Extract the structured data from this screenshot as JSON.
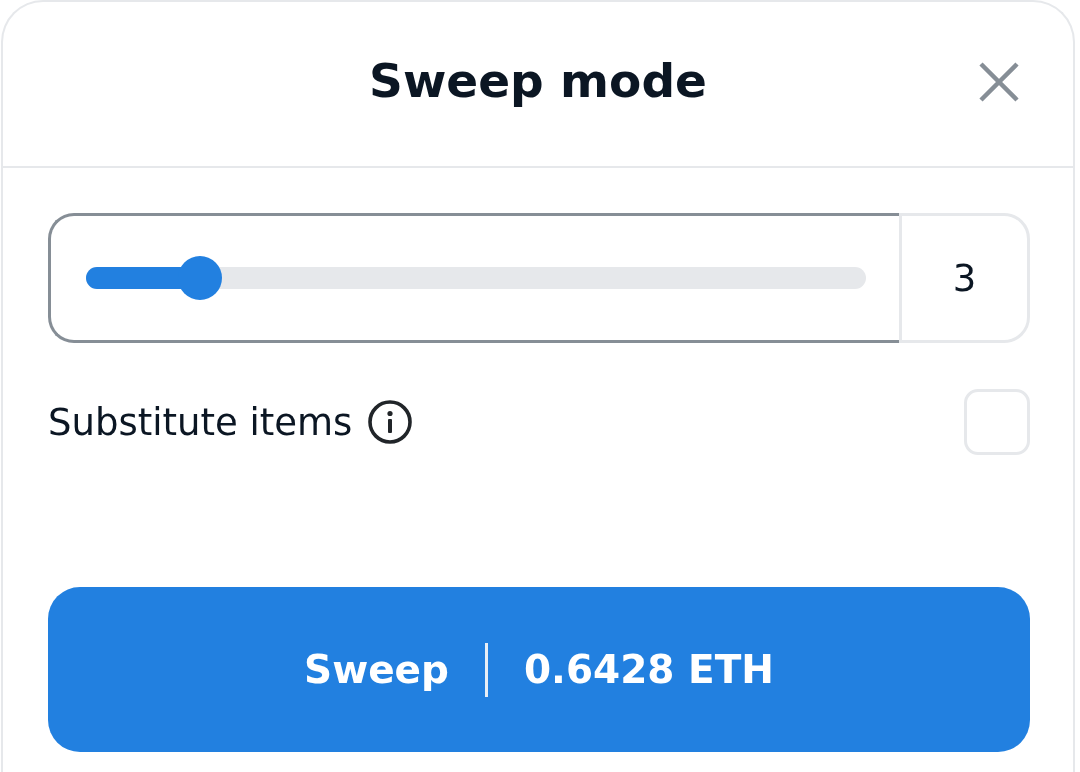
{
  "dialog": {
    "title": "Sweep mode"
  },
  "sweep_count": {
    "focused": true,
    "level": 0.125,
    "value": "3"
  },
  "substitute_items": {
    "label": "Substitute items",
    "checked": false
  },
  "sweep_button": {
    "label": "Sweep",
    "price": "0.6428 ETH"
  }
}
